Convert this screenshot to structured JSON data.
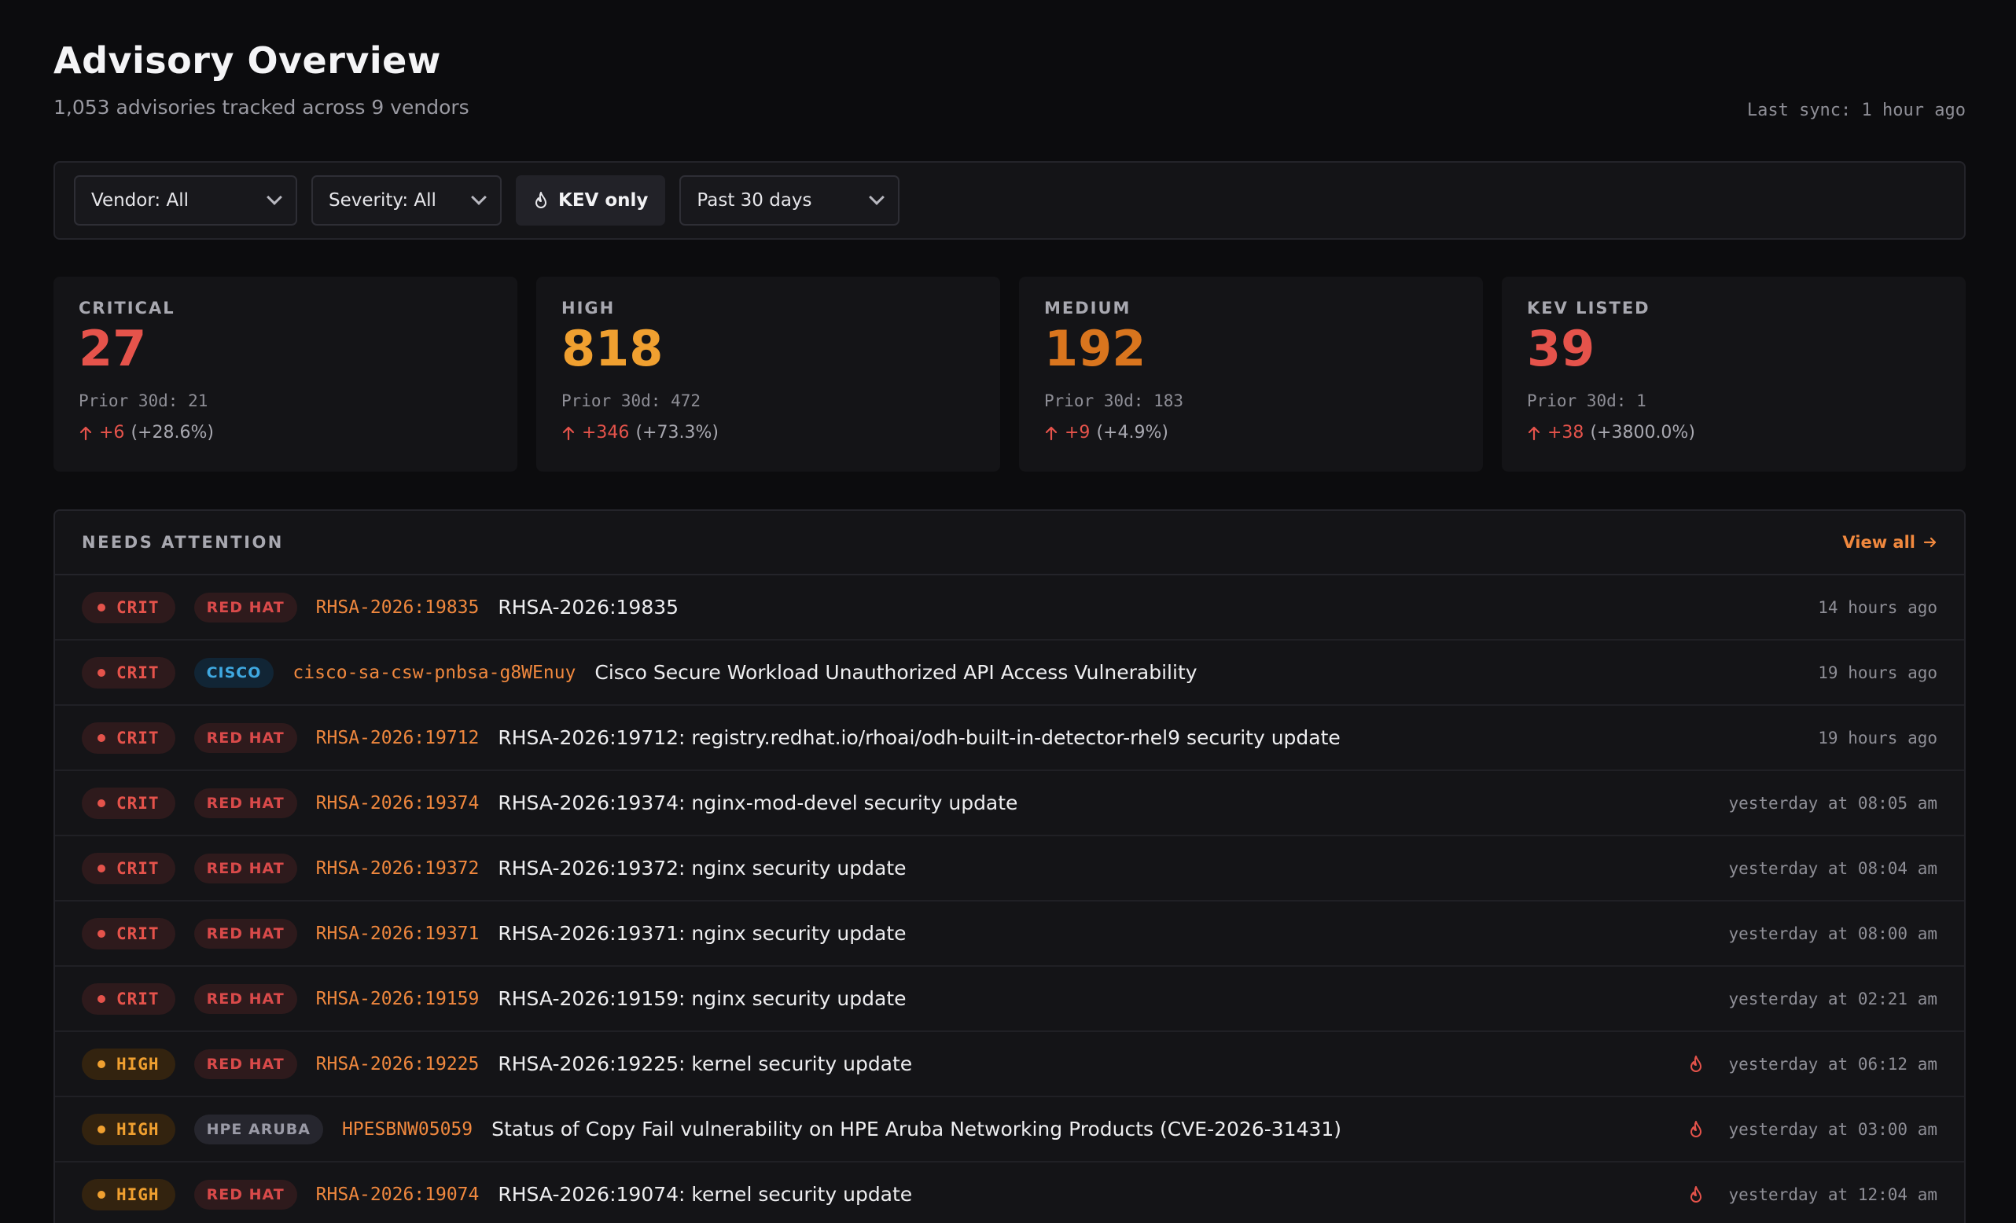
{
  "header": {
    "title": "Advisory Overview",
    "subtitle": "1,053 advisories tracked across 9 vendors",
    "last_sync": "Last sync: 1 hour ago"
  },
  "filters": {
    "vendor": "Vendor: All",
    "severity": "Severity: All",
    "kev_label": "KEV only",
    "period": "Past 30 days"
  },
  "stats": [
    {
      "label": "CRITICAL",
      "value": "27",
      "prior": "Prior 30d: 21",
      "delta": "+6",
      "pct": "(+28.6%)",
      "color": "#e5534b"
    },
    {
      "label": "HIGH",
      "value": "818",
      "prior": "Prior 30d: 472",
      "delta": "+346",
      "pct": "(+73.3%)",
      "color": "#f0a030"
    },
    {
      "label": "MEDIUM",
      "value": "192",
      "prior": "Prior 30d: 183",
      "delta": "+9",
      "pct": "(+4.9%)",
      "color": "#d9751e"
    },
    {
      "label": "KEV LISTED",
      "value": "39",
      "prior": "Prior 30d: 1",
      "delta": "+38",
      "pct": "(+3800.0%)",
      "color": "#e5534b"
    }
  ],
  "attention": {
    "title": "NEEDS ATTENTION",
    "view_all": "View all",
    "rows": [
      {
        "sev": "CRIT",
        "vendor": "RED HAT",
        "vclass": "redhat",
        "id": "RHSA-2026:19835",
        "title": "RHSA-2026:19835",
        "time": "14 hours ago",
        "kev": false
      },
      {
        "sev": "CRIT",
        "vendor": "CISCO",
        "vclass": "cisco",
        "id": "cisco-sa-csw-pnbsa-g8WEnuy",
        "title": "Cisco Secure Workload Unauthorized API Access Vulnerability",
        "time": "19 hours ago",
        "kev": false
      },
      {
        "sev": "CRIT",
        "vendor": "RED HAT",
        "vclass": "redhat",
        "id": "RHSA-2026:19712",
        "title": "RHSA-2026:19712: registry.redhat.io/rhoai/odh-built-in-detector-rhel9 security update",
        "time": "19 hours ago",
        "kev": false
      },
      {
        "sev": "CRIT",
        "vendor": "RED HAT",
        "vclass": "redhat",
        "id": "RHSA-2026:19374",
        "title": "RHSA-2026:19374: nginx-mod-devel security update",
        "time": "yesterday at 08:05 am",
        "kev": false
      },
      {
        "sev": "CRIT",
        "vendor": "RED HAT",
        "vclass": "redhat",
        "id": "RHSA-2026:19372",
        "title": "RHSA-2026:19372: nginx security update",
        "time": "yesterday at 08:04 am",
        "kev": false
      },
      {
        "sev": "CRIT",
        "vendor": "RED HAT",
        "vclass": "redhat",
        "id": "RHSA-2026:19371",
        "title": "RHSA-2026:19371: nginx security update",
        "time": "yesterday at 08:00 am",
        "kev": false
      },
      {
        "sev": "CRIT",
        "vendor": "RED HAT",
        "vclass": "redhat",
        "id": "RHSA-2026:19159",
        "title": "RHSA-2026:19159: nginx security update",
        "time": "yesterday at 02:21 am",
        "kev": false
      },
      {
        "sev": "HIGH",
        "vendor": "RED HAT",
        "vclass": "redhat",
        "id": "RHSA-2026:19225",
        "title": "RHSA-2026:19225: kernel security update",
        "time": "yesterday at 06:12 am",
        "kev": true
      },
      {
        "sev": "HIGH",
        "vendor": "HPE ARUBA",
        "vclass": "hpe",
        "id": "HPESBNW05059",
        "title": "Status of Copy Fail vulnerability on HPE Aruba Networking Products (CVE-2026-31431)",
        "time": "yesterday at 03:00 am",
        "kev": true
      },
      {
        "sev": "HIGH",
        "vendor": "RED HAT",
        "vclass": "redhat",
        "id": "RHSA-2026:19074",
        "title": "RHSA-2026:19074: kernel security update",
        "time": "yesterday at 12:04 am",
        "kev": true
      }
    ]
  }
}
